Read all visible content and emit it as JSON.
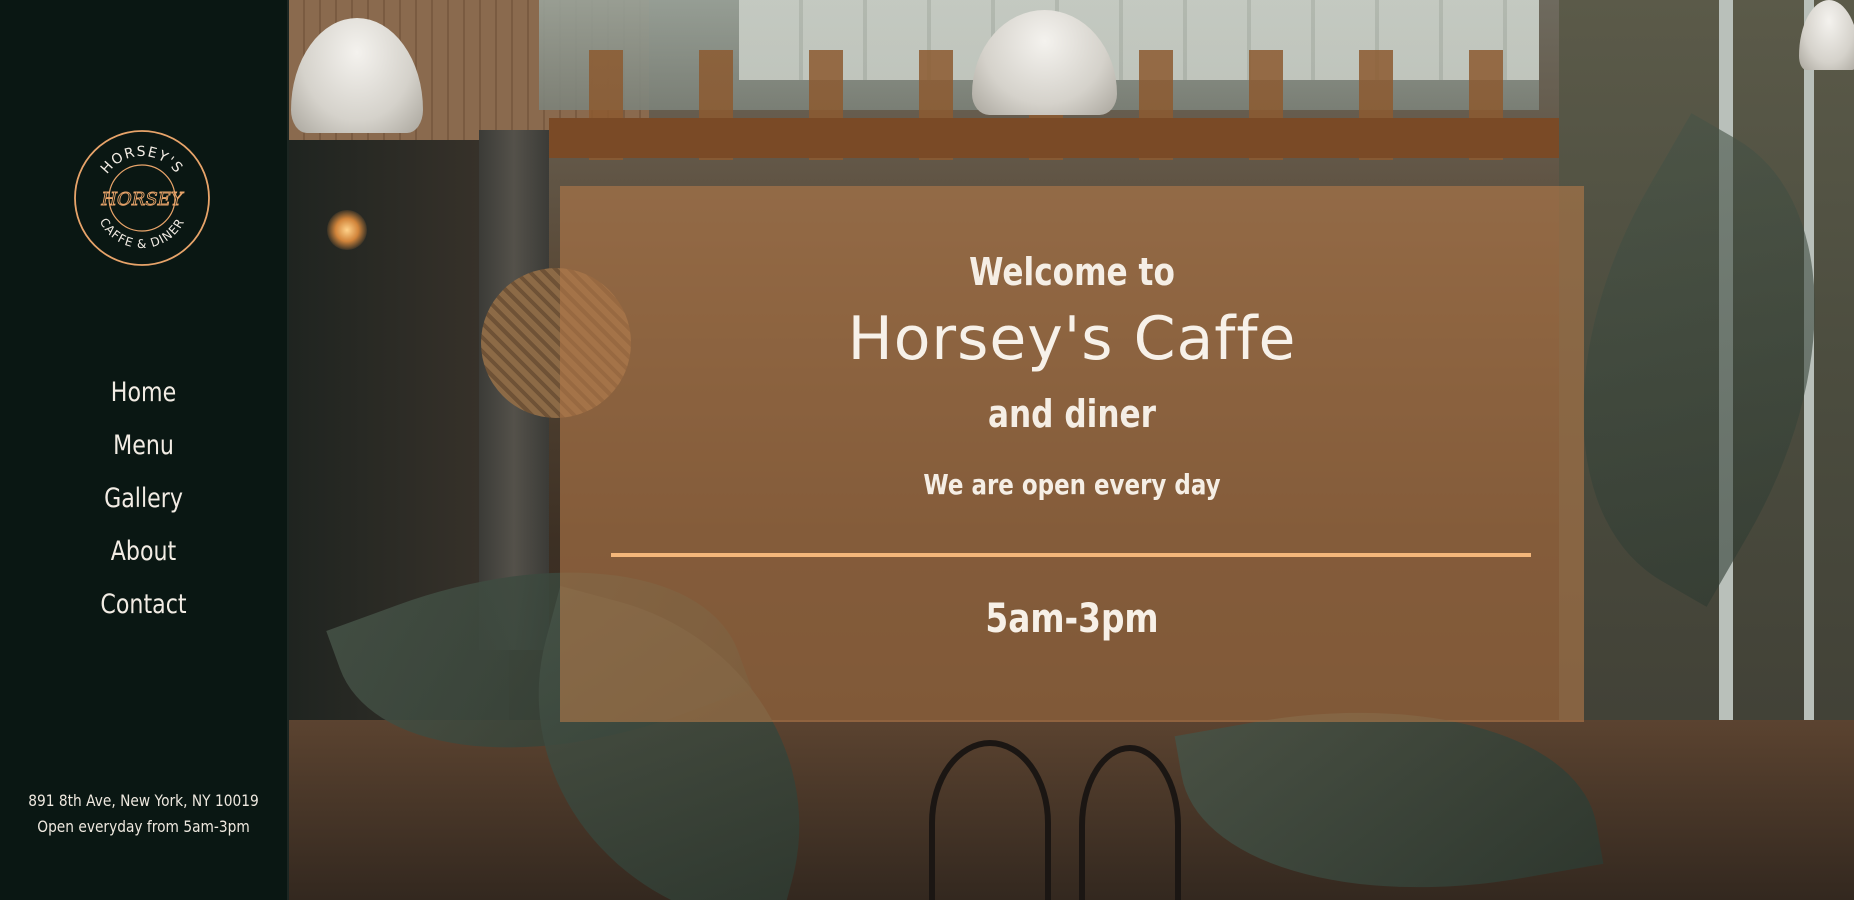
{
  "sidebar": {
    "logo": {
      "top_text": "HORSEY'S",
      "center_text": "HORSEY",
      "bottom_text": "CAFFE & DINER"
    },
    "nav": [
      {
        "label": "Home"
      },
      {
        "label": "Menu"
      },
      {
        "label": "Gallery"
      },
      {
        "label": "About"
      },
      {
        "label": "Contact"
      }
    ],
    "address_line1": "891 8th Ave, New York, NY 10019",
    "address_line2": "Open everyday from 5am-3pm"
  },
  "hero": {
    "welcome": "Welcome to",
    "brand": "Horsey's Caffe",
    "subtitle": "and diner",
    "open_days": "We are open every day",
    "hours": "5am-3pm"
  },
  "colors": {
    "sidebar_bg": "#0a1713",
    "accent": "#f4b77a",
    "panel_overlay": "#b47a4a",
    "text_light": "#f5eee5"
  }
}
